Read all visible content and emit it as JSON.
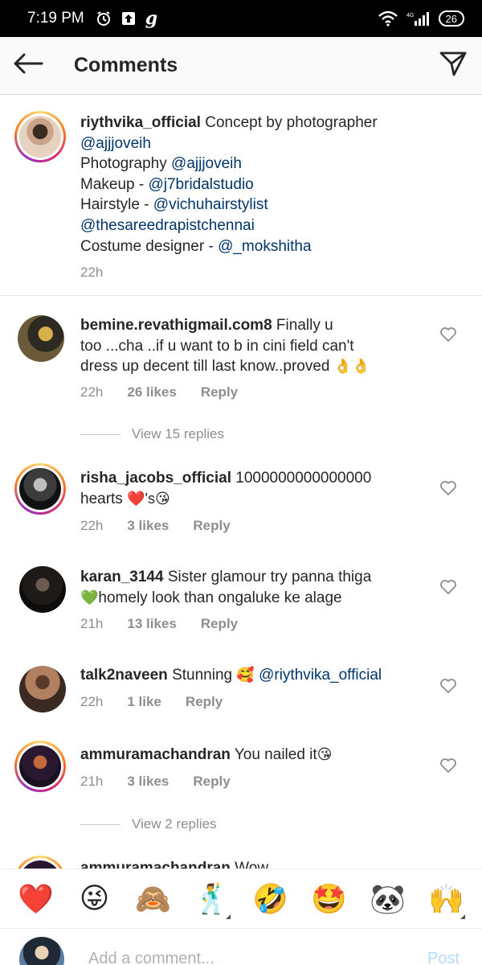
{
  "status_bar": {
    "time": "7:19 PM",
    "carrier_letter": "g",
    "network": "4G",
    "battery": "26"
  },
  "header": {
    "title": "Comments",
    "back_icon": "arrow-left-icon",
    "direct_icon": "paper-plane-icon"
  },
  "caption": {
    "username": "riythvika_official",
    "line1_text": " Concept by photographer",
    "line2_mention": "@ajjjoveih",
    "line3_text": "Photography ",
    "line3_mention": "@ajjjoveih",
    "line4_text": "Makeup - ",
    "line4_mention": "@j7bridalstudio",
    "line5_text": "Hairstyle - ",
    "line5_mention": "@vichuhairstylist",
    "line6_mention": "@thesareedrapistchennai",
    "line7_text": "Costume designer - ",
    "line7_mention": "@_mokshitha",
    "time": "22h"
  },
  "comments": [
    {
      "username": "bemine.revathigmail.com8",
      "text1": " Finally u",
      "text2": "too ...cha ..if u want to b in cini field can't",
      "text3": "dress up decent till last know..proved ",
      "emoji": "👌👌",
      "time": "22h",
      "likes": "26 likes",
      "reply": "Reply",
      "view_replies": "View 15 replies"
    },
    {
      "username": "risha_jacobs_official",
      "text1": " 1000000000000000",
      "text2": "hearts ",
      "emoji": "❤️'s😘",
      "time": "22h",
      "likes": "3 likes",
      "reply": "Reply"
    },
    {
      "username": "karan_3144",
      "text1": " Sister glamour try panna thiga",
      "text2_emoji": "💚",
      "text2": "homely look than ongaluke ke alage",
      "time": "21h",
      "likes": "13 likes",
      "reply": "Reply"
    },
    {
      "username": "talk2naveen",
      "text1": " Stunning ",
      "emoji": "🥰",
      "mention": " @riythvika_official",
      "time": "22h",
      "likes": "1 like",
      "reply": "Reply"
    },
    {
      "username": "ammuramachandran",
      "text1": " You nailed it",
      "emoji": "😘",
      "time": "21h",
      "likes": "3 likes",
      "reply": "Reply",
      "view_replies": "View 2 replies"
    }
  ],
  "cutoff_comment": {
    "username": "ammuramachandran",
    "text": " Wow"
  },
  "emoji_bar": [
    "❤️",
    "😜",
    "🙈",
    "🕺",
    "🤣",
    "🤩",
    "🐼",
    "🙌"
  ],
  "add_comment": {
    "placeholder": "Add a comment...",
    "post_label": "Post"
  },
  "colors": {
    "mention": "#003569",
    "meta_grey": "#8e8e8e",
    "post_disabled": "#b3dbff"
  }
}
